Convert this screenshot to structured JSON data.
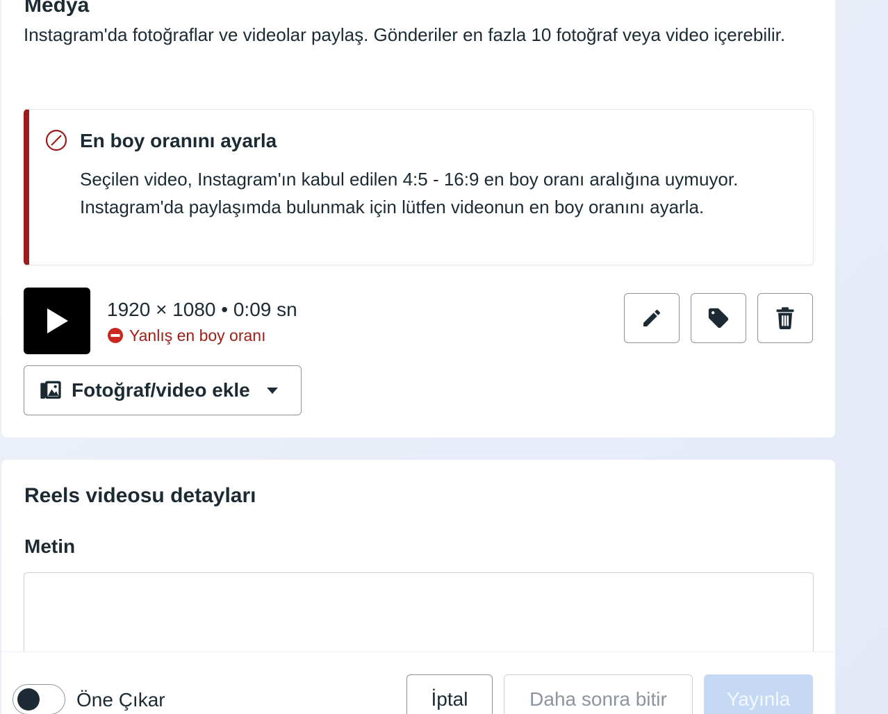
{
  "media": {
    "title": "Medya",
    "description": "Instagram'da fotoğraflar ve videolar paylaş. Gönderiler en fazla 10 fotoğraf veya video içerebilir.",
    "alert": {
      "icon": "prohibited-icon",
      "title": "En boy oranını ayarla",
      "body": "Seçilen video, Instagram'ın kabul edilen 4:5 - 16:9 en boy oranı aralığına uymuyor. Instagram'da paylaşımda bulunmak için lütfen videonun en boy oranını ayarla.",
      "accent_color": "#9b1c1c"
    },
    "video": {
      "meta": "1920 × 1080 • 0:09 sn",
      "error": "Yanlış en boy oranı",
      "error_color": "#a01e16"
    },
    "actions": {
      "edit_icon": "pencil-icon",
      "tag_icon": "tag-icon",
      "delete_icon": "trash-icon"
    },
    "add_button_label": "Fotoğraf/video ekle"
  },
  "reels": {
    "title": "Reels videosu detayları",
    "text_label": "Metin",
    "text_value": ""
  },
  "footer": {
    "toggle_label": "Öne Çıkar",
    "toggle_on": false,
    "cancel_label": "İptal",
    "later_label": "Daha sonra bitir",
    "publish_label": "Yayınla",
    "publish_color": "#c5d9f5"
  }
}
